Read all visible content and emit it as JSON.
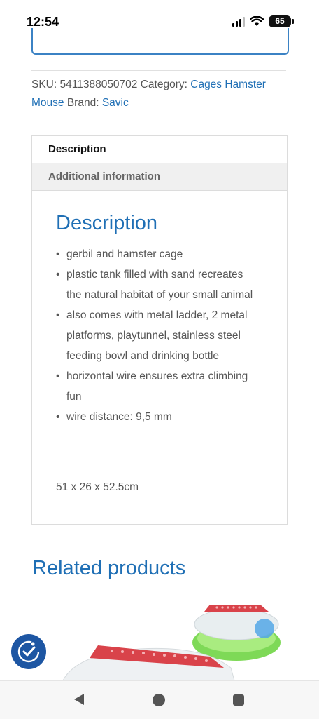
{
  "status_bar": {
    "time": "12:54",
    "battery": "65"
  },
  "meta": {
    "sku_label": "SKU:",
    "sku_value": "5411388050702",
    "category_label": "Category:",
    "category_links": [
      "Cages Hamster",
      "Mouse"
    ],
    "brand_label": "Brand:",
    "brand_value": "Savic"
  },
  "tabs": {
    "items": [
      "Description",
      "Additional information"
    ],
    "active": "Description"
  },
  "description": {
    "title": "Description",
    "bullets": [
      "gerbil and hamster cage",
      "plastic tank filled with sand recreates the natural habitat of your small animal",
      "also comes with metal ladder, 2 metal platforms, playtunnel, stainless steel feeding bowl and drinking bottle",
      "horizontal wire ensures extra climbing fun",
      "wire distance: 9,5 mm"
    ],
    "dimensions": "51 x 26 x 52.5cm"
  },
  "related": {
    "title": "Related products"
  },
  "icons": {
    "accessibility": "accessibility-icon",
    "nav_back": "back-triangle-icon",
    "nav_home": "home-circle-icon",
    "nav_recent": "recents-square-icon"
  },
  "colors": {
    "link": "#1f6fb5",
    "accessibility_button": "#1d56a3"
  }
}
